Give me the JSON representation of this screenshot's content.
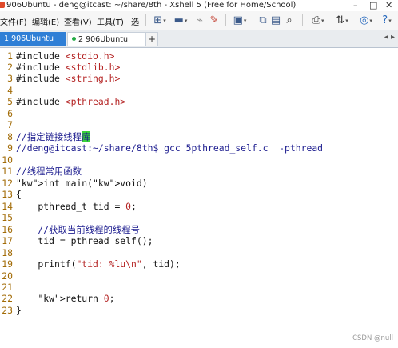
{
  "window": {
    "title": "906Ubuntu - deng@itcast: ~/share/8th - Xshell 5 (Free for Home/School)",
    "controls": [
      "–",
      "□",
      "✕"
    ]
  },
  "menu": [
    "文件(F)",
    "编辑(E)",
    "查看(V)",
    "工具(T)",
    "选"
  ],
  "toolbar_icons": [
    "new-session-icon",
    "open-folder-icon",
    "disconnect-icon",
    "color-pen-icon",
    "copy-icon",
    "paste-icon",
    "find-icon",
    "print-icon",
    "transfer-icon",
    "globe-icon",
    "help-icon"
  ],
  "tabs": [
    {
      "label": "1 906Ubuntu",
      "active": true
    },
    {
      "label": "2 906Ubuntu",
      "active": false
    }
  ],
  "add_tab_label": "+",
  "tab_nav": "◂ ▸",
  "code_lines": [
    {
      "n": "1",
      "text": "#include <stdio.h>"
    },
    {
      "n": "2",
      "text": "#include <stdlib.h>"
    },
    {
      "n": "3",
      "text": "#include <string.h>"
    },
    {
      "n": "4",
      "text": ""
    },
    {
      "n": "5",
      "text": "#include <pthread.h>"
    },
    {
      "n": "6",
      "text": ""
    },
    {
      "n": "7",
      "text": ""
    },
    {
      "n": "8",
      "text": "//指定链接线程库"
    },
    {
      "n": "9",
      "text": "//deng@itcast:~/share/8th$ gcc 5pthread_self.c  -pthread"
    },
    {
      "n": "10",
      "text": ""
    },
    {
      "n": "11",
      "text": "//线程常用函数"
    },
    {
      "n": "12",
      "text": "int main(void)"
    },
    {
      "n": "13",
      "text": "{"
    },
    {
      "n": "14",
      "text": "    pthread_t tid = 0;"
    },
    {
      "n": "15",
      "text": ""
    },
    {
      "n": "16",
      "text": "    //获取当前线程的线程号"
    },
    {
      "n": "17",
      "text": "    tid = pthread_self();"
    },
    {
      "n": "18",
      "text": ""
    },
    {
      "n": "19",
      "text": "    printf(\"tid: %lu\\n\", tid);"
    },
    {
      "n": "20",
      "text": ""
    },
    {
      "n": "21",
      "text": ""
    },
    {
      "n": "22",
      "text": "    return 0;"
    },
    {
      "n": "23",
      "text": "}"
    }
  ],
  "watermark": "CSDN @null"
}
